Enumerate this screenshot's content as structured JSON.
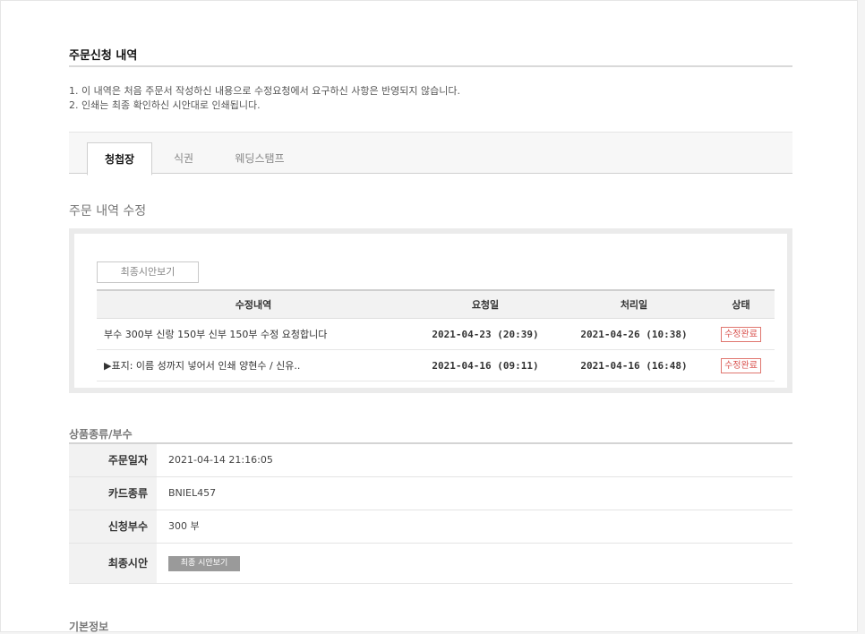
{
  "order": {
    "title": "주문신청 내역",
    "notices": [
      "1. 이 내역은 처음 주문서 작성하신 내용으로 수정요청에서 요구하신 사항은 반영되지 않습니다.",
      "2. 인쇄는 최종 확인하신 시안대로 인쇄됩니다."
    ]
  },
  "tabs": [
    {
      "label": "청첩장",
      "active": true
    },
    {
      "label": "식권",
      "active": false
    },
    {
      "label": "웨딩스탬프",
      "active": false
    }
  ],
  "edit_section": {
    "heading": "주문 내역 수정",
    "preview_button": "최종시안보기",
    "columns": [
      "수정내역",
      "요청일",
      "처리일",
      "상태"
    ],
    "rows": [
      {
        "desc": "부수 300부 신랑 150부 신부 150부 수정 요청합니다",
        "requested": "2021-04-23 (20:39)",
        "processed": "2021-04-26 (10:38)",
        "status": "수정완료"
      },
      {
        "desc": "▶표지: 이름 성까지 넣어서 인쇄 양현수 / 신유..",
        "requested": "2021-04-16 (09:11)",
        "processed": "2021-04-16 (16:48)",
        "status": "수정완료"
      }
    ]
  },
  "product": {
    "heading": "상품종류/부수",
    "order_date_label": "주문일자",
    "order_date": "2021-04-14 21:16:05",
    "card_type_label": "카드종류",
    "card_type": "BNIEL457",
    "quantity_label": "신청부수",
    "quantity": "300 부",
    "final_label": "최종시안",
    "final_button": "최종 시안보기"
  },
  "basic_info": {
    "heading": "기본정보"
  },
  "colors": {
    "status": "#d9534f",
    "button_gray": "#9a9a9a"
  }
}
